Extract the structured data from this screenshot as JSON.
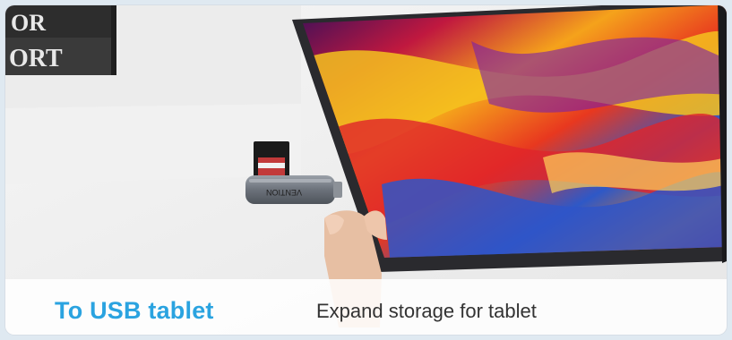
{
  "book_text": {
    "line1": "OR",
    "line2": "ORT"
  },
  "adapter_brand": "VENTION",
  "caption": {
    "title": "To USB tablet",
    "description": "Expand storage for tablet"
  },
  "colors": {
    "title": "#2aa3e0",
    "description": "#333333"
  }
}
